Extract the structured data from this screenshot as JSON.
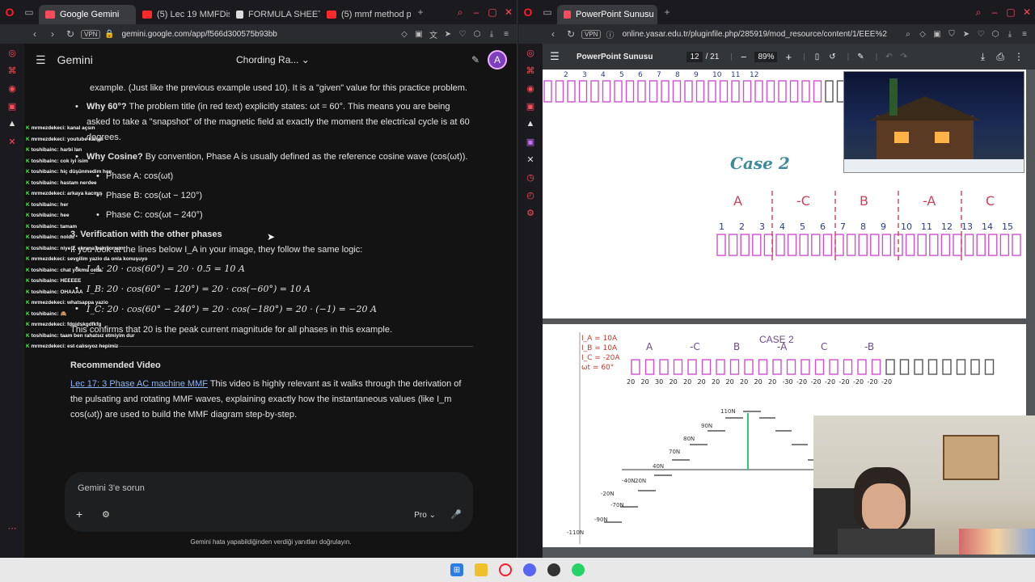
{
  "left_window": {
    "tabs": [
      {
        "label": "Google Gemini",
        "active": true
      },
      {
        "label": "(5) Lec 19 MMFDistrib",
        "active": false
      },
      {
        "label": "FORMULA SHEET-VE",
        "active": false
      },
      {
        "label": "(5) mmf method phas",
        "active": false
      }
    ],
    "vpn": "VPN",
    "url": "gemini.google.com/app/f566d300575b93bb"
  },
  "gemini": {
    "app_title": "Gemini",
    "chat_title": "Chording Ra...",
    "avatar_letter": "A",
    "para_top": "example. (Just like the previous example used 10). It is a \"given\" value for this practice problem.",
    "why60_label": "Why 60°?",
    "why60_text": " The problem title (in red text) explicitly states: ωt = 60°. This means you are being asked to take a \"snapshot\" of the magnetic field at exactly the moment the electrical cycle is at 60 degrees.",
    "whycos_label": "Why Cosine?",
    "whycos_text": " By convention, Phase A is usually defined as the reference cosine wave (cos(ωt)).",
    "phase_a": "Phase A: cos(ωt)",
    "phase_b": "Phase B: cos(ωt − 120°)",
    "phase_c": "Phase C: cos(ωt − 240°)",
    "heading3": "3. Verification with the other phases",
    "verify_intro": "If you look at the lines below I_A in your image, they follow the same logic:",
    "ia_line": "I_A: 20 · cos(60°) = 20 · 0.5 = 10 A",
    "ib_line": "I_B: 20 · cos(60° − 120°) = 20 · cos(−60°) = 10 A",
    "ic_line": "I_C: 20 · cos(60° − 240°) = 20 · cos(−180°) = 20 · (−1) = −20 A",
    "confirm": "This confirms that 20 is the peak current magnitude for all phases in this example.",
    "rec_heading": "Recommended Video",
    "rec_link": "Lec 17: 3 Phase AC machine MMF",
    "rec_text": " This video is highly relevant as it walks through the derivation of the pulsating and rotating MMF waves, explaining exactly how the instantaneous values (like I_m cos(ωt)) are used to build the MMF diagram step-by-step.",
    "input_placeholder": "Gemini 3'e sorun",
    "mode": "Pro",
    "disclaimer": "Gemini hata yapabildiğinden verdiği yanıtları doğrulayın."
  },
  "twitch_chat": [
    "mrmezdekeci: kanal açsın",
    "mrmezdekeci: youtube kanalı",
    "toshibainc: harbi lan",
    "toshibainc: cok iyi isim",
    "toshibainc: hiç düşünmedim hee",
    "toshibainc: hastam nerdee",
    "mrmezdekeci: arkaya kacmış",
    "toshibainc: her",
    "toshibainc: hee",
    "toshibainc: tamam",
    "toshibainc: noldu",
    "toshibainc: niye 2. ekrana bakıyorsun",
    "mrmezdekeci: sevgilim yazio da onla konuşuyo",
    "toshibainc: chat yokmu orda",
    "toshibainc: HEEEEE",
    "toshibainc: OHAAAA",
    "mrmezdekeci: whatsappa yazio",
    "toshibainc: 🙈",
    "mrmezdekeci: fdgjdskgdfkfg",
    "toshibainc: taam ben rahatsız etmiyim dur",
    "mrmezdekeci: est calısıyoz hepimiz"
  ],
  "right_window": {
    "tabs": [
      {
        "label": "PowerPoint Sunusu",
        "active": true
      }
    ],
    "vpn": "VPN",
    "url": "online.yasar.edu.tr/pluginfile.php/285919/mod_resource/content/1/EEE%2"
  },
  "pdf": {
    "title": "PowerPoint Sunusu",
    "page_current": "12",
    "page_total": "/ 21",
    "zoom": "89%",
    "case2_title": "Case 2",
    "page1_phase_labels": [
      "A",
      "-C",
      "B",
      "-A",
      "C"
    ],
    "page1_slot_numbers": [
      "1",
      "2",
      "3",
      "4",
      "5",
      "6",
      "7",
      "8",
      "9",
      "10",
      "11",
      "12",
      "13",
      "14",
      "15"
    ],
    "page1_top_numbers": [
      "2",
      "3",
      "4",
      "5",
      "6",
      "7",
      "8",
      "9",
      "10",
      "11",
      "12"
    ],
    "page2_currents": [
      "I_A = 10A",
      "I_B = 10A",
      "I_C = -20A",
      "ωt = 60°"
    ],
    "page2_case": "CASE 2",
    "page2_phase_labels": [
      "A",
      "-C",
      "B",
      "-A",
      "C",
      "-B"
    ],
    "page2_values": [
      "20",
      "20",
      "30",
      "20",
      "20",
      "20",
      "20",
      "20",
      "20",
      "20",
      "20",
      "-30",
      "-20",
      "-20",
      "-20",
      "-20",
      "-20",
      "-20",
      "-20"
    ],
    "page2_mmf_labels": [
      "110N",
      "90N",
      "80N",
      "70N",
      "40N",
      "20N",
      "-20N",
      "-40N",
      "-70N",
      "-90N",
      "-110N"
    ]
  },
  "taskbar": [
    "windows-start",
    "file-explorer",
    "opera-gx",
    "discord",
    "obs",
    "whatsapp"
  ]
}
